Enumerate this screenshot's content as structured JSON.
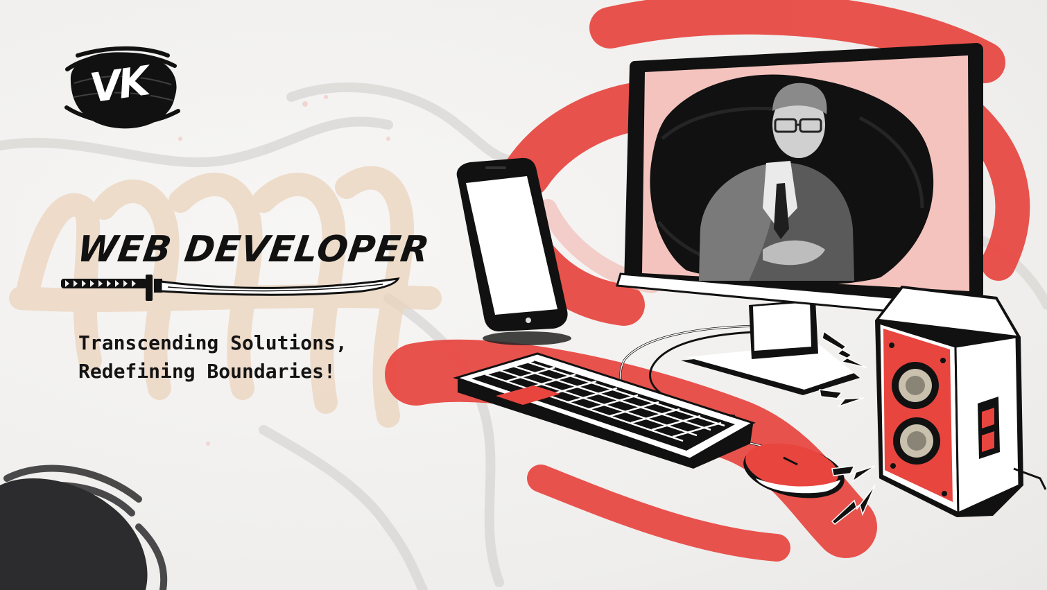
{
  "logo": {
    "text": "VK",
    "icon": "brush-stroke-monogram"
  },
  "hero": {
    "title": "WEB DEVELOPER",
    "tagline_line1": "Transcending Solutions,",
    "tagline_line2": "Redefining Boundaries!"
  },
  "illustration": {
    "description_icons": [
      "katana-icon",
      "smartphone-icon",
      "monitor-icon",
      "keyboard-icon",
      "mouse-icon",
      "speaker-icon"
    ]
  },
  "colors": {
    "accent_red": "#e8453f",
    "ink_black": "#111111",
    "paper": "#f2f1f0",
    "beige": "#ecd4bd"
  }
}
